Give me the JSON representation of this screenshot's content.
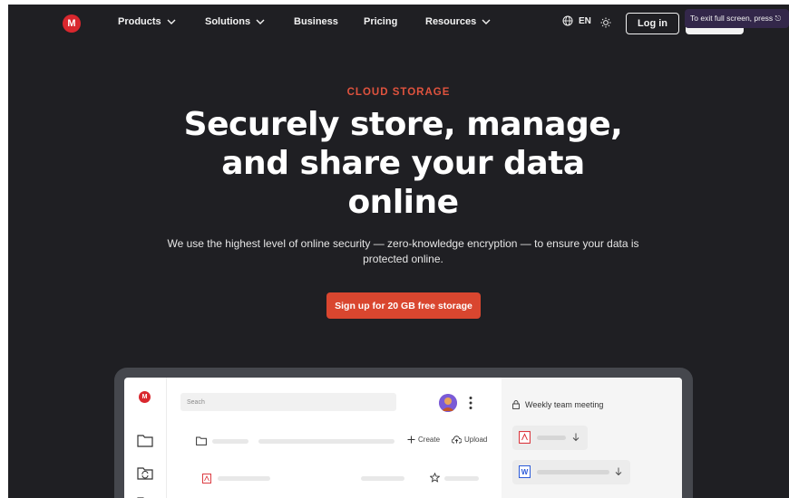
{
  "nav": {
    "logo_letter": "M",
    "items": [
      {
        "label": "Products",
        "has_dropdown": true
      },
      {
        "label": "Solutions",
        "has_dropdown": true
      },
      {
        "label": "Business",
        "has_dropdown": false
      },
      {
        "label": "Pricing",
        "has_dropdown": false
      },
      {
        "label": "Resources",
        "has_dropdown": true
      }
    ],
    "language": "EN",
    "login_label": "Log in",
    "toast": "To exit full screen, press ⎋"
  },
  "hero": {
    "eyebrow": "CLOUD STORAGE",
    "headline": "Securely store, manage, and share your data online",
    "subtext": "We use the highest level of online security — zero-knowledge encryption — to ensure your data is protected online.",
    "cta_label": "Sign up for 20 GB free storage"
  },
  "mockup": {
    "logo_letter": "M",
    "search_placeholder": "Seach",
    "create_label": "Create",
    "upload_label": "Upload",
    "meeting_title": "Weekly team meeting",
    "word_badge": "W"
  },
  "colors": {
    "background": "#1f1f23",
    "brand_red": "#d9272e",
    "accent": "#e0533e",
    "cta": "#d9462f"
  }
}
